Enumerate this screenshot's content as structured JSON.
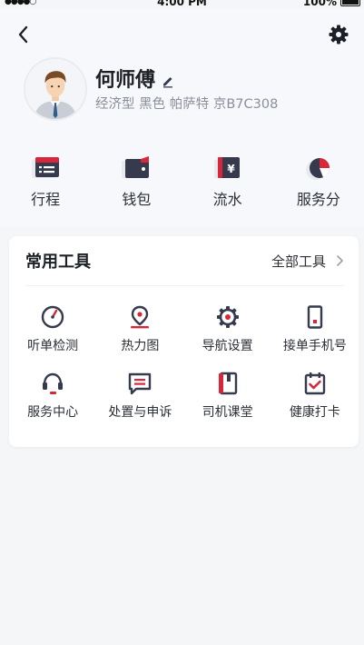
{
  "status_bar": {
    "signal": "●●●●○",
    "time": "4:00 PM",
    "battery": "100%"
  },
  "profile": {
    "name": "何师傅",
    "car_info": "经济型 黑色 帕萨特 京B7C308"
  },
  "quick_actions": [
    {
      "label": "行程",
      "icon": "trip-list-icon"
    },
    {
      "label": "钱包",
      "icon": "wallet-icon"
    },
    {
      "label": "流水",
      "icon": "income-statement-icon"
    },
    {
      "label": "服务分",
      "icon": "service-score-pie-icon"
    }
  ],
  "tools": {
    "title": "常用工具",
    "all_label": "全部工具",
    "items": [
      {
        "label": "听单检测",
        "icon": "gauge-icon"
      },
      {
        "label": "热力图",
        "icon": "map-pin-icon"
      },
      {
        "label": "导航设置",
        "icon": "gear-icon"
      },
      {
        "label": "接单手机号",
        "icon": "phone-icon"
      },
      {
        "label": "服务中心",
        "icon": "headset-icon"
      },
      {
        "label": "处置与申诉",
        "icon": "message-icon"
      },
      {
        "label": "司机课堂",
        "icon": "book-icon"
      },
      {
        "label": "健康打卡",
        "icon": "calendar-check-icon"
      }
    ]
  },
  "colors": {
    "accent_red": "#d8263a",
    "icon_dark": "#353b4d",
    "icon_light": "#e8eaf0"
  }
}
